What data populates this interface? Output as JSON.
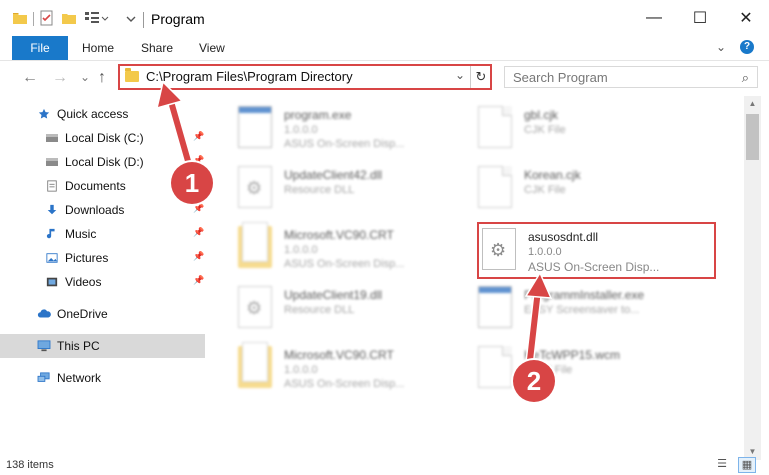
{
  "window": {
    "title": "Program",
    "minimize_glyph": "—",
    "maximize_glyph": "☐",
    "close_glyph": "✕"
  },
  "ribbon": {
    "tabs": [
      "File",
      "Home",
      "Share",
      "View"
    ],
    "expand_glyph": "⌄",
    "help_glyph": "?"
  },
  "nav": {
    "back_glyph": "←",
    "forward_glyph": "→",
    "recent_glyph": "⌄",
    "up_glyph": "↑",
    "address": "C:\\Program Files\\Program Directory",
    "address_dropdown_glyph": "⌄",
    "refresh_glyph": "↻",
    "search_placeholder": "Search Program",
    "search_glyph": "⌕"
  },
  "sidebar": {
    "pin_glyph": "📌",
    "items": [
      {
        "label": "Quick access",
        "icon": "star-icon",
        "pinned": false
      },
      {
        "label": "Local Disk (C:)",
        "icon": "drive-icon",
        "pinned": true
      },
      {
        "label": "Local Disk (D:)",
        "icon": "drive-icon",
        "pinned": true
      },
      {
        "label": "Documents",
        "icon": "documents-icon",
        "pinned": true
      },
      {
        "label": "Downloads",
        "icon": "download-icon",
        "pinned": true
      },
      {
        "label": "Music",
        "icon": "music-icon",
        "pinned": true
      },
      {
        "label": "Pictures",
        "icon": "pictures-icon",
        "pinned": true
      },
      {
        "label": "Videos",
        "icon": "videos-icon",
        "pinned": true
      },
      {
        "label": "OneDrive",
        "icon": "cloud-icon",
        "pinned": false
      },
      {
        "label": "This PC",
        "icon": "computer-icon",
        "pinned": false,
        "selected": true
      },
      {
        "label": "Network",
        "icon": "network-icon",
        "pinned": false
      }
    ]
  },
  "files": [
    {
      "name": "program.exe",
      "line1": "1.0.0.0",
      "line2": "ASUS On-Screen Disp...",
      "icon": "exe-icon",
      "blurred": true
    },
    {
      "name": "gbl.cjk",
      "line1": "CJK File",
      "line2": "",
      "icon": "document-icon",
      "blurred": true
    },
    {
      "name": "UpdateClient42.dll",
      "line1": "Resource DLL",
      "line2": "",
      "icon": "gear-file-icon",
      "blurred": true
    },
    {
      "name": "Korean.cjk",
      "line1": "CJK File",
      "line2": "",
      "icon": "document-icon",
      "blurred": true
    },
    {
      "name": "Microsoft.VC90.CRT",
      "line1": "1.0.0.0",
      "line2": "ASUS On-Screen Disp...",
      "icon": "folder-icon",
      "blurred": true
    },
    {
      "name": "asusosdnt.dll",
      "line1": "1.0.0.0",
      "line2": "ASUS On-Screen Disp...",
      "icon": "gear-file-icon",
      "blurred": false
    },
    {
      "name": "UpdateClient19.dll",
      "line1": "Resource DLL",
      "line2": "",
      "icon": "gear-file-icon",
      "blurred": true
    },
    {
      "name": "ProgrammInstaller.exe",
      "line1": "EASY Screensaver to...",
      "line2": "",
      "icon": "exe-icon",
      "blurred": true
    },
    {
      "name": "Microsoft.VC90.CRT",
      "line1": "1.0.0.0",
      "line2": "ASUS On-Screen Disp...",
      "icon": "folder-icon",
      "blurred": true
    },
    {
      "name": "HeTcWPP15.wcm",
      "line1": "WCM File",
      "line2": "",
      "icon": "document-icon",
      "blurred": true
    }
  ],
  "status": {
    "item_count": "138 items",
    "details_view_glyph": "☰",
    "icons_view_glyph": "▦"
  },
  "callouts": {
    "one": "1",
    "two": "2"
  },
  "colors": {
    "accent": "#1979ca",
    "highlight": "#d84545"
  }
}
